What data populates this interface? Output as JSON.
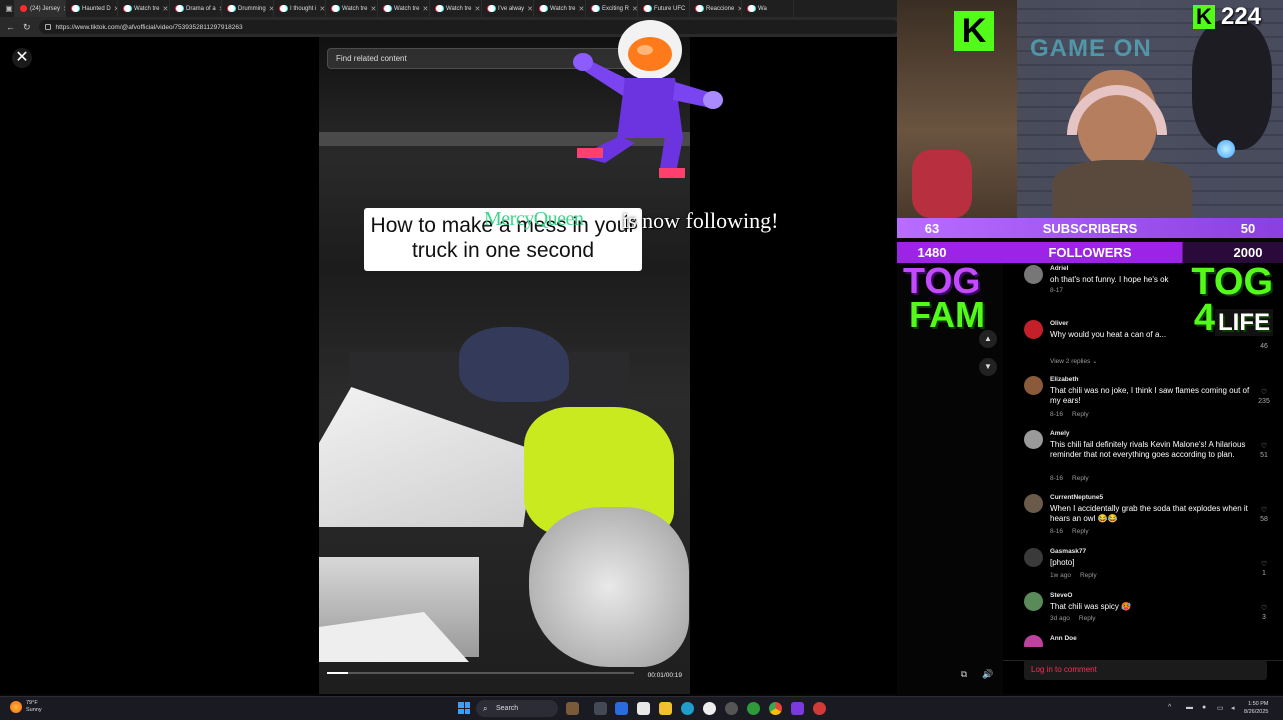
{
  "browser": {
    "tabs": [
      {
        "label": "(24) Jersey",
        "active": true
      },
      {
        "label": "Haunted D"
      },
      {
        "label": "Watch tre"
      },
      {
        "label": "Drama of a"
      },
      {
        "label": "Drumming"
      },
      {
        "label": "I thought i"
      },
      {
        "label": "Watch tre"
      },
      {
        "label": "Watch tre"
      },
      {
        "label": "Watch tre"
      },
      {
        "label": "I've alway"
      },
      {
        "label": "Watch tre"
      },
      {
        "label": "Exciting R"
      },
      {
        "label": "Future UFC"
      },
      {
        "label": "Reaccione"
      },
      {
        "label": "Wa"
      }
    ],
    "url": "https://www.tiktok.com/@afvofficial/video/7539352811297918263"
  },
  "tiktok": {
    "related_placeholder": "Find related content",
    "caption": "How to make a mess in your truck in one second",
    "time": "00:01/00:19",
    "progress_fraction": 0.07,
    "login_text": "Log in to comment"
  },
  "stream": {
    "follow_name": "MercyQueen",
    "follow_text": "is now following!",
    "viewer_count": "224",
    "k_letter": "K",
    "game_on": "GAME ON",
    "subs": {
      "current": "63",
      "label": "SUBSCRIBERS",
      "goal": "50"
    },
    "followers": {
      "current": "1480",
      "label": "FOLLOWERS",
      "goal": "2000"
    },
    "tog_fam": {
      "tog": "TOG",
      "fam": "FAM"
    },
    "tog_4life": {
      "tog": "TOG",
      "four": "4",
      "life": "LIFE"
    }
  },
  "comments": [
    {
      "name": "Adriel",
      "text": "oh that's not funny. I hope he's ok",
      "date": "8-17",
      "likes": ""
    },
    {
      "name": "Oliver",
      "text": "Why would you heat a can of a...",
      "date": "",
      "likes": "46"
    },
    {
      "name": "Elizabeth",
      "text": "That chili was no joke, I think I saw flames coming out of my ears!",
      "date": "8-16",
      "reply": "Reply",
      "likes": "235"
    },
    {
      "name": "Amely",
      "text": "This chili fail definitely rivals Kevin Malone's! A hilarious reminder that not everything goes according to plan.",
      "date": "8-16",
      "reply": "Reply",
      "likes": "51"
    },
    {
      "name": "CurrentNeptune5",
      "text": "When I accidentally grab the soda that explodes when it hears an owl 😂😂",
      "date": "8-16",
      "reply": "Reply",
      "likes": "58"
    },
    {
      "name": "Gasmask77",
      "text": "[photo]",
      "date": "1w ago",
      "reply": "Reply",
      "likes": "1"
    },
    {
      "name": "SteveO",
      "text": "That chili was spicy 🥵",
      "date": "3d ago",
      "reply": "Reply",
      "likes": "3"
    },
    {
      "name": "Ann Doe",
      "text": "",
      "date": "",
      "likes": ""
    }
  ],
  "view_replies": "View 2 replies ⌄",
  "taskbar": {
    "weather_temp": "79°F",
    "weather_desc": "Sunny",
    "search": "Search",
    "time": "1:50 PM",
    "date": "8/26/2025"
  }
}
